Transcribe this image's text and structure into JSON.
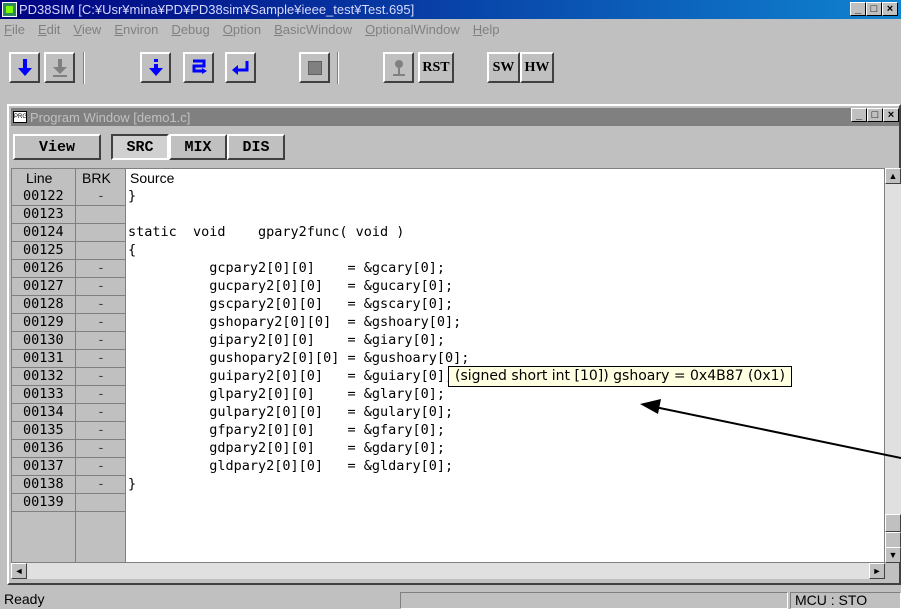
{
  "window": {
    "title": "PD38SIM [C:¥Usr¥mina¥PD¥PD38sim¥Sample¥ieee_test¥Test.695]",
    "minimize": "_",
    "maximize": "□",
    "close": "×"
  },
  "menu": [
    "File",
    "Edit",
    "View",
    "Environ",
    "Debug",
    "Option",
    "BasicWindow",
    "OptionalWindow",
    "Help"
  ],
  "toolbar": {
    "rst": "RST",
    "sw": "SW",
    "hw": "HW"
  },
  "program_window": {
    "title": "Program Window [demo1.c]",
    "icon_text": "PRG",
    "view_button": "View",
    "modes": [
      "SRC",
      "MIX",
      "DIS"
    ],
    "columns": {
      "line": "Line",
      "brk": "BRK",
      "source": "Source"
    },
    "rows": [
      {
        "line": "00122",
        "brk": "-",
        "src": "}"
      },
      {
        "line": "00123",
        "brk": "",
        "src": ""
      },
      {
        "line": "00124",
        "brk": "",
        "src": "static  void    gpary2func( void )"
      },
      {
        "line": "00125",
        "brk": "",
        "src": "{"
      },
      {
        "line": "00126",
        "brk": "-",
        "src": "          gcpary2[0][0]    = &gcary[0];"
      },
      {
        "line": "00127",
        "brk": "-",
        "src": "          gucpary2[0][0]   = &gucary[0];"
      },
      {
        "line": "00128",
        "brk": "-",
        "src": "          gscpary2[0][0]   = &gscary[0];"
      },
      {
        "line": "00129",
        "brk": "-",
        "src": "          gshopary2[0][0]  = &gshoary[0];"
      },
      {
        "line": "00130",
        "brk": "-",
        "src": "          gipary2[0][0]    = &giary[0];"
      },
      {
        "line": "00131",
        "brk": "-",
        "src": "          gushopary2[0][0] = &gushoary[0];"
      },
      {
        "line": "00132",
        "brk": "-",
        "src": "          guipary2[0][0]   = &guiary[0];"
      },
      {
        "line": "00133",
        "brk": "-",
        "src": "          glpary2[0][0]    = &glary[0];"
      },
      {
        "line": "00134",
        "brk": "-",
        "src": "          gulpary2[0][0]   = &gulary[0];"
      },
      {
        "line": "00135",
        "brk": "-",
        "src": "          gfpary2[0][0]    = &gfary[0];"
      },
      {
        "line": "00136",
        "brk": "-",
        "src": "          gdpary2[0][0]    = &gdary[0];"
      },
      {
        "line": "00137",
        "brk": "-",
        "src": "          gldpary2[0][0]   = &gldary[0];"
      },
      {
        "line": "00138",
        "brk": "-",
        "src": "}"
      },
      {
        "line": "00139",
        "brk": "",
        "src": ""
      }
    ],
    "tooltip": "(signed short int [10]) gshoary = 0x4B87 (0x1)"
  },
  "status": {
    "text": "Ready",
    "mcu": "MCU : STO"
  },
  "colors": {
    "title_active": "#000080",
    "title_inactive": "#808080",
    "tooltip_bg": "#ffffe1",
    "arrow_blue": "#0000ff"
  }
}
